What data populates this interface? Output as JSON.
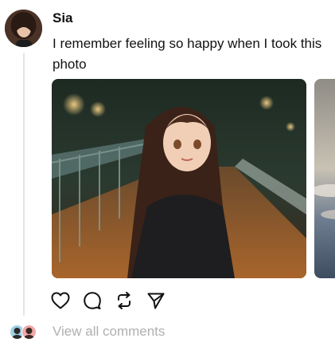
{
  "post": {
    "author": "Sia",
    "caption": "I remember feeling so happy when I took this photo",
    "avatar_icon": "user-avatar-icon",
    "photo_icon": "photo-girl-on-bridge-night",
    "next_photo_icon": "photo-sky-clouds"
  },
  "actions": {
    "like_icon": "heart-icon",
    "comment_icon": "comment-bubble-icon",
    "repost_icon": "repost-arrows-icon",
    "share_icon": "send-paper-plane-icon"
  },
  "comments": {
    "view_all_label": "View all comments",
    "commenter_icons": [
      "commenter-avatar-icon",
      "commenter-avatar-icon"
    ]
  },
  "colors": {
    "text": "#111111",
    "muted": "#b0b0b0",
    "thread_line": "#e4e4e4"
  }
}
